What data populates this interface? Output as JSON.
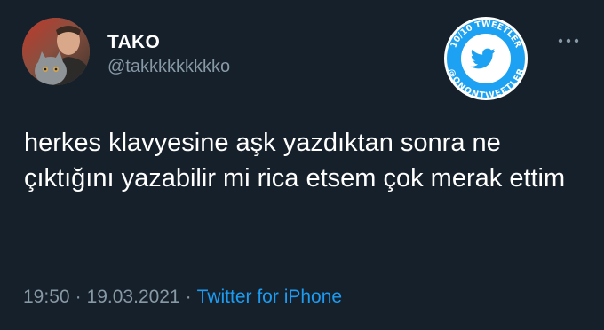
{
  "tweet": {
    "display_name": "TAKO",
    "handle": "@takkkkkkkkko",
    "text": "herkes klavyesine aşk yazdıktan sonra ne çıktığını yazabilir mi rica etsem çok merak ettim",
    "time": "19:50",
    "separator": "·",
    "date": "19.03.2021",
    "source": "Twitter for iPhone"
  },
  "watermark": {
    "top_text": "10/10 TWEETLER",
    "bottom_text": "@ONONTWEETLER",
    "icon": "twitter-bird-icon"
  },
  "icons": {
    "more": "more-dots-icon",
    "avatar": "profile-photo"
  },
  "colors": {
    "background": "#15202b",
    "text_primary": "#ffffff",
    "text_secondary": "#8899a6",
    "link": "#1d9bf0",
    "twitter_blue": "#1da1f2"
  }
}
